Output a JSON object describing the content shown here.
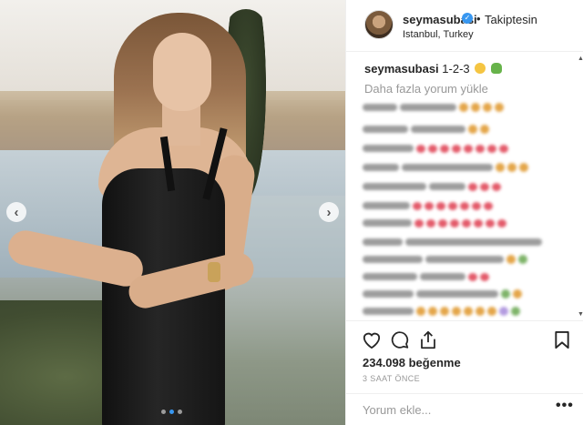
{
  "post": {
    "username": "seymasubasi",
    "follow_separator": "•",
    "follow_state": "Takiptesin",
    "location": "Istanbul, Turkey",
    "caption_user": "seymasubasi",
    "caption_text": "1-2-3",
    "load_more": "Daha fazla yorum yükle",
    "likes": "234.098 beğenme",
    "timestamp": "3 SAAT ÖNCE",
    "comment_placeholder": "Yorum ekle...",
    "more_label": "•••"
  },
  "carousel": {
    "prev_glyph": "‹",
    "next_glyph": "›",
    "slide_count": 3,
    "active_slide": 2
  },
  "icons": {
    "verified": "verified-badge-icon",
    "like": "heart-icon",
    "comment": "comment-bubble-icon",
    "share": "share-icon",
    "save": "bookmark-icon"
  },
  "colors": {
    "accent": "#3897f0",
    "text": "#262626",
    "muted": "#999999",
    "border": "#efefef"
  }
}
